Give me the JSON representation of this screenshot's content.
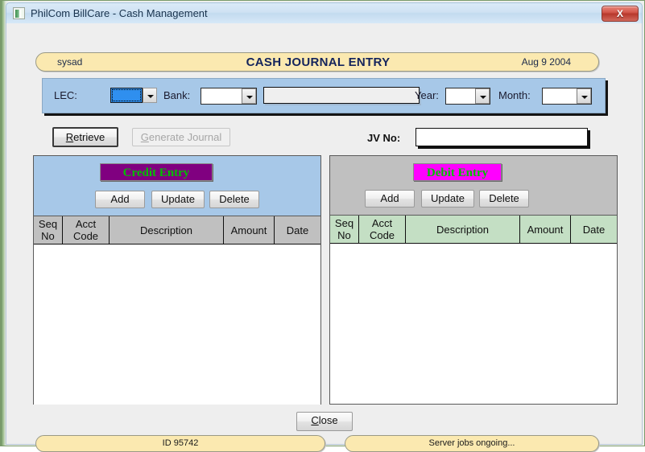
{
  "window": {
    "title": "PhilCom BillCare - Cash Management",
    "close_label": "X",
    "app_icon": "app-icon"
  },
  "header": {
    "user": "sysad",
    "title": "CASH JOURNAL ENTRY",
    "date": "Aug 9 2004"
  },
  "filter": {
    "lec_label": "LEC:",
    "lec_value": "",
    "bank_label": "Bank:",
    "bank_value": "",
    "bank_name_value": "",
    "year_label": "Year:",
    "year_value": "",
    "month_label": "Month:",
    "month_value": ""
  },
  "actions": {
    "retrieve_label": "Retrieve",
    "retrieve_accel": "R",
    "retrieve_rest": "etrieve",
    "generate_accel": "G",
    "generate_rest": "enerate Journal",
    "generate_label": "Generate Journal",
    "jv_label": "JV No:",
    "jv_value": ""
  },
  "credit": {
    "title": "Credit Entry",
    "add_label": "Add",
    "update_label": "Update",
    "delete_label": "Delete",
    "columns": [
      "Seq\nNo",
      "Acct\nCode",
      "Description",
      "Amount",
      "Date"
    ],
    "rows": []
  },
  "debit": {
    "title": "Debit Entry",
    "add_label": "Add",
    "update_label": "Update",
    "delete_label": "Delete",
    "columns": [
      "Seq\nNo",
      "Acct\nCode",
      "Description",
      "Amount",
      "Date"
    ],
    "rows": []
  },
  "footer": {
    "close_accel": "C",
    "close_rest": "lose",
    "close_label": "Close",
    "id_text": "ID 95742",
    "status_text": "Server jobs ongoing..."
  },
  "colors": {
    "header_capsule": "#fbe9b0",
    "filter_panel": "#a7c8e8",
    "credit_panel": "#a7c8e8",
    "debit_panel": "#c0c0c0",
    "credit_title_bg": "#800080",
    "debit_title_bg": "#ff00ff",
    "entry_title_fg": "#00c000",
    "credit_head_bg": "#c0c0c0",
    "debit_head_bg": "#c4dfc4",
    "close_button": "#b8382c",
    "lec_selected": "#2f8fef"
  }
}
